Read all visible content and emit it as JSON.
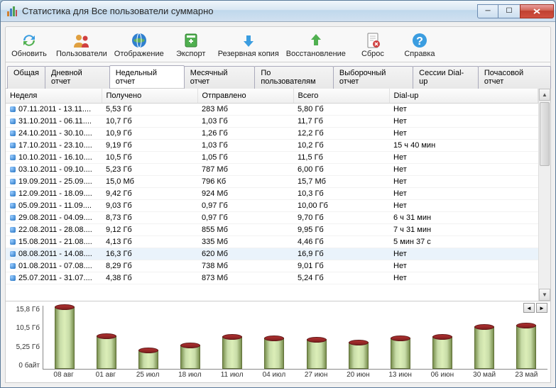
{
  "window": {
    "title": "Статистика для Все пользователи суммарно"
  },
  "toolbar": [
    {
      "id": "refresh",
      "label": "Обновить"
    },
    {
      "id": "users",
      "label": "Пользователи"
    },
    {
      "id": "display",
      "label": "Отображение"
    },
    {
      "id": "export",
      "label": "Экспорт"
    },
    {
      "id": "backup",
      "label": "Резервная копия"
    },
    {
      "id": "restore",
      "label": "Восстановление"
    },
    {
      "id": "reset",
      "label": "Сброс"
    },
    {
      "id": "help",
      "label": "Справка"
    }
  ],
  "tabs": [
    "Общая",
    "Дневной отчет",
    "Недельный отчет",
    "Месячный отчет",
    "По пользователям",
    "Выборочный отчет",
    "Сессии Dial-up",
    "Почасовой отчет"
  ],
  "active_tab": 2,
  "columns": [
    "Неделя",
    "Получено",
    "Отправлено",
    "Всего",
    "Dial-up"
  ],
  "rows": [
    {
      "week": "07.11.2011 - 13.11....",
      "recv": "5,53 Гб",
      "sent": "283 Мб",
      "total": "5,80 Гб",
      "dialup": "Нет"
    },
    {
      "week": "31.10.2011 - 06.11....",
      "recv": "10,7 Гб",
      "sent": "1,03 Гб",
      "total": "11,7 Гб",
      "dialup": "Нет"
    },
    {
      "week": "24.10.2011 - 30.10....",
      "recv": "10,9 Гб",
      "sent": "1,26 Гб",
      "total": "12,2 Гб",
      "dialup": "Нет"
    },
    {
      "week": "17.10.2011 - 23.10....",
      "recv": "9,19 Гб",
      "sent": "1,03 Гб",
      "total": "10,2 Гб",
      "dialup": "15 ч 40 мин"
    },
    {
      "week": "10.10.2011 - 16.10....",
      "recv": "10,5 Гб",
      "sent": "1,05 Гб",
      "total": "11,5 Гб",
      "dialup": "Нет"
    },
    {
      "week": "03.10.2011 - 09.10....",
      "recv": "5,23 Гб",
      "sent": "787 Мб",
      "total": "6,00 Гб",
      "dialup": "Нет"
    },
    {
      "week": "19.09.2011 - 25.09....",
      "recv": "15,0 Мб",
      "sent": "796 Кб",
      "total": "15,7 Мб",
      "dialup": "Нет"
    },
    {
      "week": "12.09.2011 - 18.09....",
      "recv": "9,42 Гб",
      "sent": "924 Мб",
      "total": "10,3 Гб",
      "dialup": "Нет"
    },
    {
      "week": "05.09.2011 - 11.09....",
      "recv": "9,03 Гб",
      "sent": "0,97 Гб",
      "total": "10,00 Гб",
      "dialup": "Нет"
    },
    {
      "week": "29.08.2011 - 04.09....",
      "recv": "8,73 Гб",
      "sent": "0,97 Гб",
      "total": "9,70 Гб",
      "dialup": "6 ч 31 мин"
    },
    {
      "week": "22.08.2011 - 28.08....",
      "recv": "9,12 Гб",
      "sent": "855 Мб",
      "total": "9,95 Гб",
      "dialup": "7 ч 31 мин"
    },
    {
      "week": "15.08.2011 - 21.08....",
      "recv": "4,13 Гб",
      "sent": "335 Мб",
      "total": "4,46 Гб",
      "dialup": "5 мин 37 с"
    },
    {
      "week": "08.08.2011 - 14.08....",
      "recv": "16,3 Гб",
      "sent": "620 Мб",
      "total": "16,9 Гб",
      "dialup": "Нет",
      "sel": true
    },
    {
      "week": "01.08.2011 - 07.08....",
      "recv": "8,29 Гб",
      "sent": "738 Мб",
      "total": "9,01 Гб",
      "dialup": "Нет"
    },
    {
      "week": "25.07.2011 - 31.07....",
      "recv": "4,38 Гб",
      "sent": "873 Мб",
      "total": "5,24 Гб",
      "dialup": "Нет"
    }
  ],
  "chart_data": {
    "type": "bar",
    "categories": [
      "08 авг",
      "01 авг",
      "25 июл",
      "18 июл",
      "11 июл",
      "04 июл",
      "27 июн",
      "20 июн",
      "13 июн",
      "06 июн",
      "30 май",
      "23 май"
    ],
    "values": [
      16.9,
      9.0,
      5.2,
      6.5,
      8.8,
      8.5,
      8.0,
      7.2,
      8.5,
      8.8,
      11.5,
      11.8
    ],
    "y_ticks": [
      "15,8 Гб",
      "10,5 Гб",
      "5,25 Гб",
      "0 байт"
    ],
    "ylim": [
      0,
      17
    ]
  }
}
